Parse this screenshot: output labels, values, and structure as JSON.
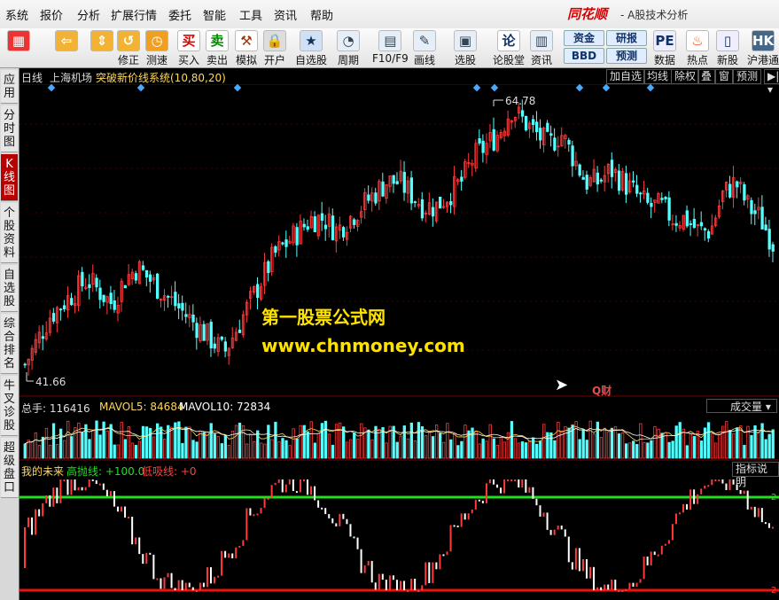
{
  "menu": {
    "items": [
      "系统",
      "报价",
      "分析",
      "扩展行情",
      "委托",
      "智能",
      "工具",
      "资讯",
      "帮助"
    ],
    "brand": "同花顺",
    "brand_sub": "- A股技术分析"
  },
  "toolbar": {
    "buttons": [
      {
        "label": "",
        "icon": "color-grid-icon"
      },
      {
        "label": "",
        "icon": "back-arrow-icon"
      },
      {
        "label": "",
        "icon": "up-down-arrow-icon"
      },
      {
        "label": "修正",
        "icon": "correct-icon"
      },
      {
        "label": "测速",
        "icon": "speed-test-icon"
      },
      {
        "label": "买入",
        "icon": "buy-icon"
      },
      {
        "label": "卖出",
        "icon": "sell-icon"
      },
      {
        "label": "模拟",
        "icon": "hammer-icon"
      },
      {
        "label": "开户",
        "icon": "lock-icon"
      },
      {
        "label": "自选股",
        "icon": "star-icon"
      },
      {
        "label": "周期",
        "icon": "clock-icon"
      },
      {
        "label": "F10/F9",
        "icon": "f10-icon"
      },
      {
        "label": "画线",
        "icon": "pencil-icon"
      },
      {
        "label": "选股",
        "icon": "screen-icon"
      },
      {
        "label": "论股堂",
        "icon": "discuss-icon"
      },
      {
        "label": "资讯",
        "icon": "news-icon"
      },
      {
        "label": "资金",
        "icon": "fund-badge"
      },
      {
        "label": "BBD",
        "icon": "bbd-badge"
      },
      {
        "label": "研报",
        "icon": "report-badge"
      },
      {
        "label": "预测",
        "icon": "forecast-badge"
      },
      {
        "label": "数据",
        "icon": "pe-icon"
      },
      {
        "label": "热点",
        "icon": "hot-icon"
      },
      {
        "label": "新股",
        "icon": "ipo-icon"
      },
      {
        "label": "沪港通",
        "icon": "hk-connect-icon"
      }
    ]
  },
  "sidebar": {
    "tabs": [
      "应用",
      "分时图",
      "K线图",
      "个股资料",
      "自选股",
      "综合排名",
      "牛叉诊股",
      "超级盘口"
    ],
    "active": "K线图"
  },
  "chart_header": {
    "period": "日线",
    "stock": "上海机场",
    "indicator": "突破新价线系统(10,80,20)",
    "buttons": [
      "加自选",
      "均线",
      "除权",
      "叠",
      "窗",
      "预测"
    ]
  },
  "price_panel": {
    "high_label": "64.78",
    "low_label": "41.66",
    "watermark_title": "第一股票公式网",
    "watermark_url": "www.chnmoney.com",
    "q_label": "Q财"
  },
  "volume_panel": {
    "label_total": "总手: 116416",
    "label_mavol5": "MAVOL5: 84684",
    "label_mavol10": "MAVOL10: 72834",
    "selector": "成交量"
  },
  "indicator_panel": {
    "name": "我的未来",
    "high_line": "高抛线: +100.0",
    "low_line": "低吸线: +0",
    "explain_button": "指标说明",
    "right_top": "2",
    "right_bottom": "2"
  },
  "colors": {
    "up": "#ff3b3b",
    "down": "#54ffff",
    "accent": "#c00000",
    "green_line": "#22dd22",
    "red_line": "#ee1111"
  },
  "chart_data": {
    "type": "candlestick",
    "title": "上海机场 日线",
    "price_max": 64.78,
    "price_min": 41.66,
    "close_trend": [
      43,
      45,
      47,
      48,
      49,
      50,
      49,
      48,
      50,
      51,
      50,
      49,
      48,
      47,
      46,
      45,
      44,
      46,
      48,
      50,
      52,
      53,
      54,
      55,
      55,
      54,
      55,
      56,
      57,
      58,
      58,
      57,
      56,
      56,
      57,
      58,
      60,
      61,
      62,
      64,
      63,
      62,
      61,
      62,
      60,
      58,
      58,
      59,
      58,
      57,
      56,
      56,
      55,
      55,
      54,
      54,
      57,
      58,
      56,
      55,
      53
    ]
  }
}
